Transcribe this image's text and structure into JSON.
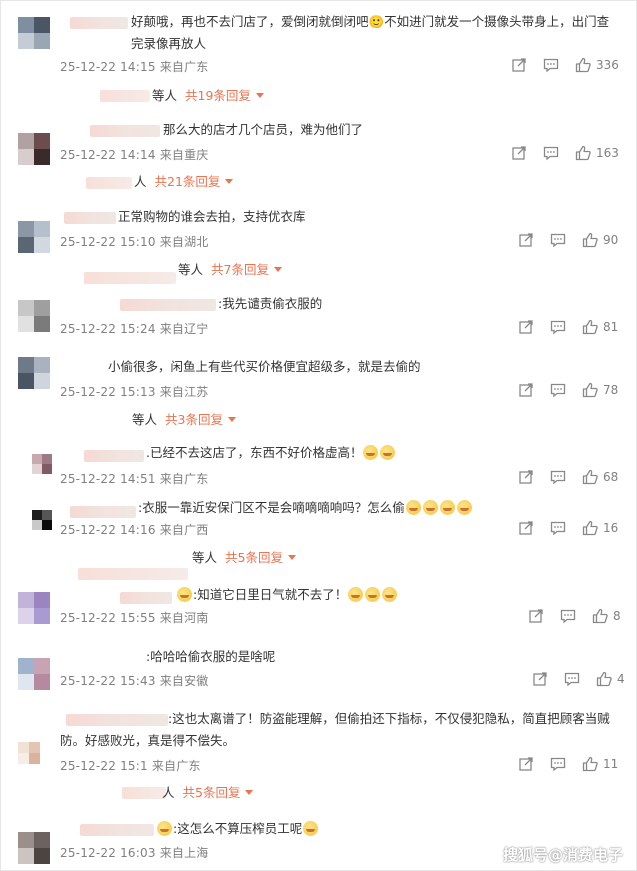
{
  "comments": [
    {
      "text": "好颠哦，再也不去门店了，爱倒闭就倒闭吧🙂不如进门就发一个摄像头带身上，出门查完录像再放人",
      "time": "25-12-22 14:15",
      "loc": "来自广东",
      "likes": "336",
      "replies": {
        "who": "等人",
        "count": "共19条回复"
      },
      "avatar": [
        "#7f8ea0",
        "#4a5665",
        "#c4ccd6",
        "#9aa6b4"
      ]
    },
    {
      "text": "那么大的店才几个店员，难为他们了",
      "time": "25-12-22 14:14",
      "loc": "来自重庆",
      "likes": "163",
      "replies": {
        "who": "人",
        "count": "共21条回复"
      },
      "avatar": [
        "#b0a2a2",
        "#6b4d4d",
        "#d8cccc",
        "#3b2a2a"
      ]
    },
    {
      "text": "正常购物的谁会去拍，支持优衣库",
      "time": "25-12-22 15:10",
      "loc": "来自湖北",
      "likes": "90",
      "replies": {
        "who": "等人",
        "count": "共7条回复"
      },
      "avatar": [
        "#8c97a5",
        "#b6c0cc",
        "#5b6675",
        "#d2d8e0"
      ]
    },
    {
      "text": ":我先谴责偷衣服的",
      "time": "25-12-22 15:24",
      "loc": "来自辽宁",
      "likes": "81",
      "replies": null,
      "avatar": [
        "#c7c7c7",
        "#9f9f9f",
        "#e1e1e1",
        "#7b7b7b"
      ]
    },
    {
      "text": "小偷很多，闲鱼上有些代买价格便宜超级多，就是去偷的",
      "time": "25-12-22 15:13",
      "loc": "来自江苏",
      "likes": "78",
      "replies": {
        "who": "等人",
        "count": "共3条回复"
      },
      "avatar": [
        "#6e7a88",
        "#a9b2be",
        "#4a5563",
        "#cfd5dc"
      ]
    },
    {
      "text": ".已经不去这店了，东西不好价格虚高！",
      "time": "25-12-22 14:51",
      "loc": "来自广东",
      "likes": "68",
      "replies": null,
      "avatar": [
        "#c9a9b0",
        "#9e7a84",
        "#e3d2d6",
        "#7f5b64"
      ]
    },
    {
      "text": ":衣服一靠近安保门区不是会嘀嘀嘀响吗？怎么偷",
      "time": "25-12-22 14:16",
      "loc": "来自广西",
      "likes": "16",
      "replies": {
        "who": "等人",
        "count": "共5条回复"
      },
      "avatar": [
        "#1d1d1d",
        "#565656",
        "#c9c9c9",
        "#0a0a0a"
      ]
    },
    {
      "text": ":知道它日里日气就不去了！",
      "time": "25-12-22 15:55",
      "loc": "来自河南",
      "likes": "8",
      "replies": null,
      "avatar": [
        "#c2b3d9",
        "#9c84c0",
        "#ddd2ec",
        "#a99ad0"
      ]
    },
    {
      "text": ":哈哈哈偷衣服的是啥呢",
      "time": "25-12-22 15:43",
      "loc": "来自安徽",
      "likes": "4",
      "replies": null,
      "avatar": [
        "#9fb3cc",
        "#c7a3b4",
        "#dfe6ef",
        "#b58aa0"
      ]
    },
    {
      "text": ":这也太离谱了！防盗能理解，但偷拍还下指标，不仅侵犯隐私，简直把顾客当贼防。好感败光，真是得不偿失。",
      "time": "25-12-22 15:1",
      "loc": "来自广东",
      "likes": "11",
      "replies": {
        "who": "人",
        "count": "共5条回复"
      },
      "avatar": [
        "#f1e1d6",
        "#e4c5b2",
        "#f7ede6",
        "#d9b39c"
      ]
    },
    {
      "text": ":这怎么不算压榨员工呢",
      "time": "25-12-22 16:03",
      "loc": "来自上海",
      "likes": "",
      "replies": null,
      "avatar": [
        "#9a8f8a",
        "#6c625e",
        "#cbc4c0",
        "#4c4441"
      ]
    }
  ],
  "watermark": "搜狐号@消费电子",
  "colors": {
    "accent": "#eb7350",
    "meta": "#808080",
    "text": "#333333"
  },
  "icons": [
    "share-icon",
    "comment-icon",
    "like-icon"
  ]
}
